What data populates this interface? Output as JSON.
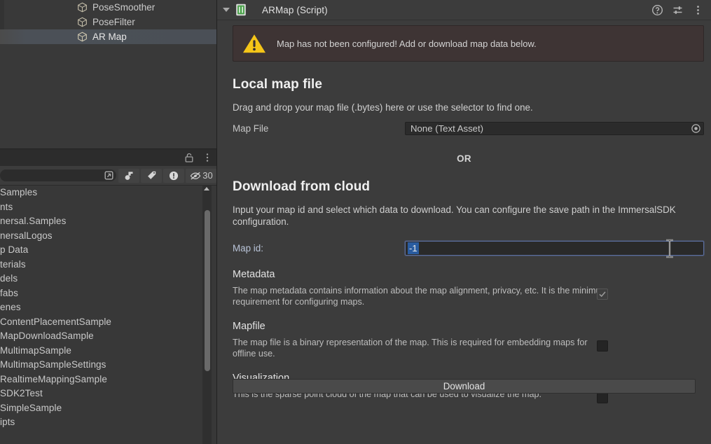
{
  "hierarchy": {
    "items": [
      {
        "label": "PoseSmoother",
        "icon": "cube-icon",
        "selected": false
      },
      {
        "label": "PoseFilter",
        "icon": "cube-icon",
        "selected": false
      },
      {
        "label": "AR Map",
        "icon": "cube-icon",
        "selected": true
      }
    ]
  },
  "project_panel": {
    "tabbar": {
      "lock_icon": "lock-icon",
      "menu_icon": "kebab-menu-icon"
    },
    "toolbar": {
      "search_placeholder": "",
      "search_value": "",
      "buttons": [
        {
          "icon": "collapse-icon",
          "label": ""
        },
        {
          "icon": "clear-on-play-icon",
          "label": ""
        },
        {
          "icon": "tag-icon",
          "label": ""
        },
        {
          "icon": "error-icon",
          "label": ""
        },
        {
          "icon": "hidden-objects-icon",
          "label": "30"
        }
      ],
      "hidden_count": "30"
    },
    "files": [
      "Samples",
      "nts",
      "nersal.Samples",
      "nersalLogos",
      "p Data",
      "terials",
      "dels",
      "fabs",
      "enes",
      "ContentPlacementSample",
      "MapDownloadSample",
      "MultimapSample",
      "MultimapSampleSettings",
      "RealtimeMappingSample",
      "SDK2Test",
      "SimpleSample",
      "ipts"
    ]
  },
  "inspector": {
    "header": {
      "title": "ARMap (Script)",
      "foldout_icon": "chevron-down-icon",
      "script_icon": "script-icon",
      "help_icon": "help-icon",
      "preset_icon": "preset-sliders-icon",
      "menu_icon": "kebab-menu-icon"
    },
    "warning": {
      "icon": "warning-triangle-icon",
      "text": "Map has not been configured! Add or download map data below.",
      "accent_color": "#f5c518",
      "bg_color": "#3e3434"
    },
    "local_map_file": {
      "title": "Local map file",
      "description": "Drag and drop your map file (.bytes) here or use the selector to find one.",
      "field_label": "Map File",
      "field_value": "None (Text Asset)",
      "selector_icon": "object-selector-icon"
    },
    "or_label": "OR",
    "download_from_cloud": {
      "title": "Download from cloud",
      "description": "Input your map id and select which data to download. You can configure the save path in the ImmersalSDK configuration.",
      "map_id_label": "Map id:",
      "map_id_value": "-1",
      "map_id_selected": true,
      "map_id_focus_color": "#5a6e9e",
      "map_id_selection_color": "#2a5ca0",
      "cursor_icon": "text-ibeam-cursor",
      "options": [
        {
          "title": "Metadata",
          "description": "The map metadata contains information about the map alignment, privacy, etc. It is the minimum requirement for configuring maps.",
          "checked": true,
          "disabled": true
        },
        {
          "title": "Mapfile",
          "description": "The map file is a binary representation of the map. This is required for embedding maps for offline use.",
          "checked": false,
          "disabled": false
        },
        {
          "title": "Visualization",
          "description": "This is the sparse point cloud of the map that can be used to visualize the map.",
          "checked": false,
          "disabled": false
        }
      ],
      "download_button": "Download"
    }
  }
}
